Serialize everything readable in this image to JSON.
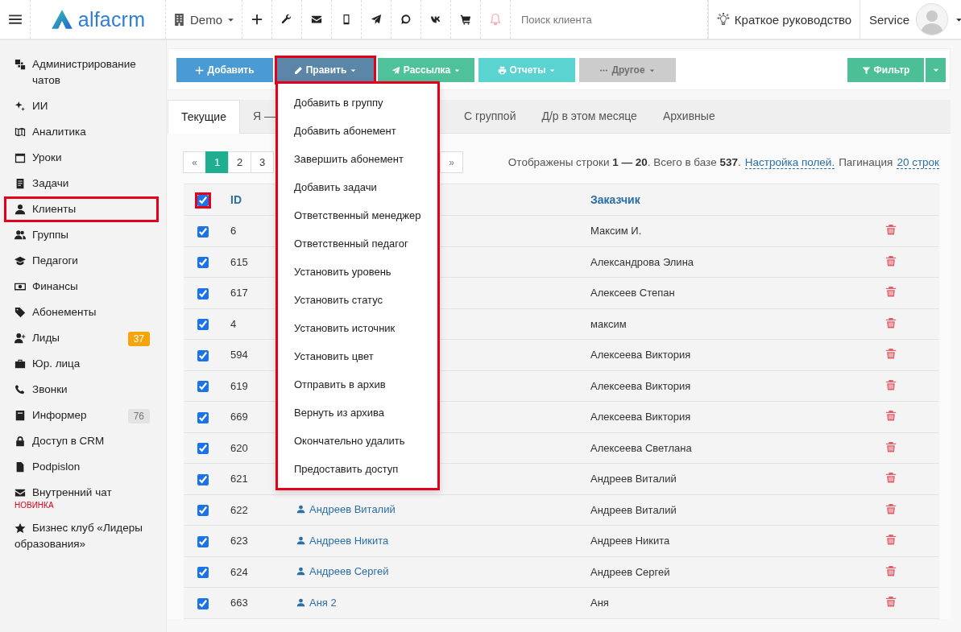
{
  "header": {
    "brand": "alfacrm",
    "branch": "Demo",
    "search": {
      "placeholder": "Поиск клиента"
    },
    "guide": "Краткое руководство",
    "user": "Service"
  },
  "sidebar": {
    "items": [
      {
        "label": "Администрирование чатов",
        "highlighted": false
      },
      {
        "label": "ИИ",
        "highlighted": false
      },
      {
        "label": "Аналитика",
        "highlighted": false
      },
      {
        "label": "Уроки",
        "highlighted": false
      },
      {
        "label": "Задачи",
        "highlighted": false
      },
      {
        "label": "Клиенты",
        "highlighted": true
      },
      {
        "label": "Группы",
        "highlighted": false
      },
      {
        "label": "Педагоги",
        "highlighted": false
      },
      {
        "label": "Финансы",
        "highlighted": false
      },
      {
        "label": "Абонементы",
        "highlighted": false
      },
      {
        "label": "Лиды",
        "highlighted": false,
        "badge": {
          "text": "37",
          "color": "#f5a40c"
        }
      },
      {
        "label": "Юр. лица",
        "highlighted": false
      },
      {
        "label": "Звонки",
        "highlighted": false
      },
      {
        "label": "Информер",
        "highlighted": false,
        "badge": {
          "text": "76",
          "color": "#e3e3e3"
        }
      },
      {
        "label": "Доступ в CRM",
        "highlighted": false
      },
      {
        "label": "Podpislon",
        "highlighted": false
      },
      {
        "label": "Внутренний чат",
        "highlighted": false,
        "note": "НОВИНКА"
      },
      {
        "label": "Бизнес клуб «Лидеры образования»",
        "highlighted": false
      }
    ]
  },
  "toolbar": {
    "buttons": [
      {
        "label": "Добавить",
        "color": "#4a9bd4",
        "dropdown": false,
        "highlighted": false,
        "disabled": false
      },
      {
        "label": "Править",
        "color": "#5b86a8",
        "dropdown": true,
        "highlighted": true,
        "disabled": false
      },
      {
        "label": "Рассылка",
        "color": "#4fc19b",
        "dropdown": true,
        "highlighted": false,
        "disabled": false
      },
      {
        "label": "Отчеты",
        "color": "#5ad3d1",
        "dropdown": true,
        "highlighted": false,
        "disabled": false
      },
      {
        "label": "Другое",
        "color": "#cccccc",
        "dropdown": true,
        "highlighted": false,
        "disabled": true
      }
    ],
    "filter": {
      "label": "Фильтр",
      "color": "#4dbf96"
    }
  },
  "menu": {
    "highlighted": true,
    "items": [
      "Добавить в группу",
      "Добавить абонемент",
      "Завершить абонемент",
      "Добавить задачи",
      "Ответственный менеджер",
      "Ответственный педагог",
      "Установить уровень",
      "Установить статус",
      "Установить источник",
      "Установить цвет",
      "Отправить в архив",
      "Вернуть из архива",
      "Окончательно удалить",
      "Предоставить доступ"
    ]
  },
  "tabs": [
    {
      "label": "Текущие",
      "selected": true
    },
    {
      "label": "Я —",
      "selected": false
    },
    {
      "label": "С группой",
      "selected": false
    },
    {
      "label": "Д/р в этом месяце",
      "selected": false
    },
    {
      "label": "Архивные",
      "selected": false
    }
  ],
  "pagination": {
    "pages": [
      {
        "label": "«",
        "kind": "prev",
        "selected": false
      },
      {
        "label": "1",
        "kind": "page",
        "selected": true
      },
      {
        "label": "2",
        "kind": "page",
        "selected": false
      },
      {
        "label": "3",
        "kind": "page",
        "selected": false
      },
      {
        "label": "»",
        "kind": "next",
        "selected": false
      }
    ],
    "info": "Отображены строки **1 — 20**. Всего в базе **537**.",
    "fields_link": "Настройка полей.",
    "per_page_label": "Пагинация",
    "per_page": "20 строк"
  },
  "table": {
    "header_checkbox": {
      "checked": true,
      "highlighted": true
    },
    "id_header": "ID",
    "customer_header": "Заказчик",
    "rows": [
      {
        "checked": true,
        "id": "6",
        "customer": "Максим И."
      },
      {
        "checked": true,
        "id": "615",
        "customer": "Александрова Элина"
      },
      {
        "checked": true,
        "id": "617",
        "customer": "Алексеев Степан"
      },
      {
        "checked": true,
        "id": "4",
        "customer": "максим"
      },
      {
        "checked": true,
        "id": "594",
        "customer": "Алексеева Виктория"
      },
      {
        "checked": true,
        "id": "619",
        "customer": "Алексеева Виктория"
      },
      {
        "checked": true,
        "id": "669",
        "customer": "Алексеева Виктория"
      },
      {
        "checked": true,
        "id": "620",
        "customer": "Алексеева Светлана"
      },
      {
        "checked": true,
        "id": "621",
        "customer": "Андреев Виталий"
      },
      {
        "checked": true,
        "id": "622",
        "client": "Андреев Виталий",
        "customer": "Андреев Виталий"
      },
      {
        "checked": true,
        "id": "623",
        "client": "Андреев Никита",
        "customer": "Андреев Никита"
      },
      {
        "checked": true,
        "id": "624",
        "client": "Андреев Сергей",
        "customer": "Андреев Сергей"
      },
      {
        "checked": true,
        "id": "663",
        "client": "Аня 2",
        "customer": "Аня"
      }
    ]
  }
}
